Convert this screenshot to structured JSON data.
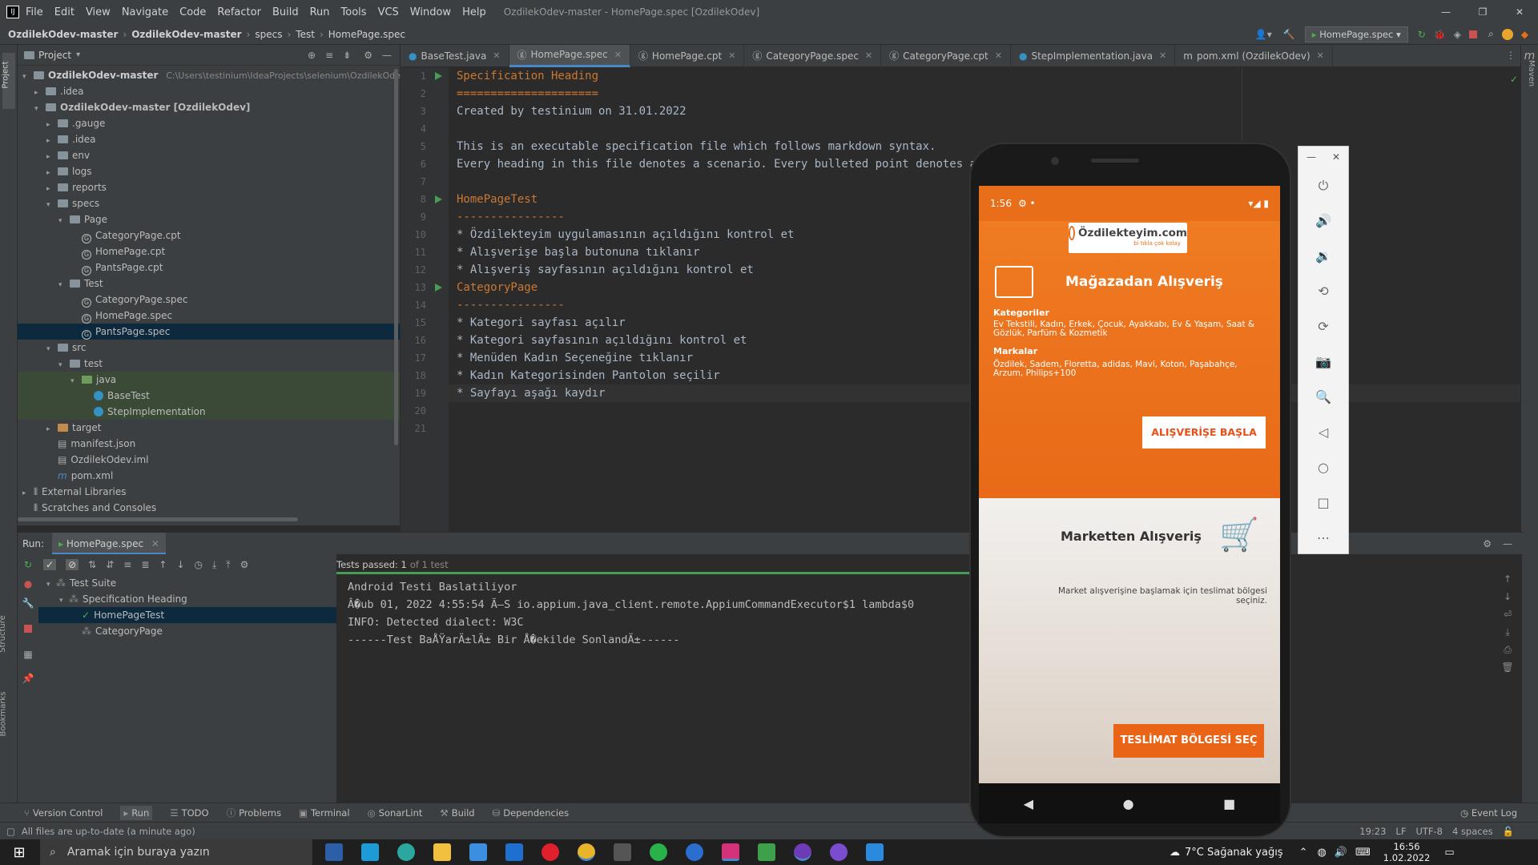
{
  "window": {
    "title": "OzdilekOdev-master - HomePage.spec [OzdilekOdev]"
  },
  "menu": [
    "File",
    "Edit",
    "View",
    "Navigate",
    "Code",
    "Refactor",
    "Build",
    "Run",
    "Tools",
    "VCS",
    "Window",
    "Help"
  ],
  "breadcrumb": [
    "OzdilekOdev-master",
    "OzdilekOdev-master",
    "specs",
    "Test",
    "HomePage.spec"
  ],
  "run_config": "HomePage.spec",
  "project": {
    "title": "Project",
    "root": "OzdilekOdev-master",
    "root_path": "C:\\Users\\testinium\\IdeaProjects\\selenium\\OzdilekOdev-m",
    "nodes": [
      {
        "label": ".idea",
        "depth": 1,
        "type": "folder",
        "arrow": "▸"
      },
      {
        "label": "OzdilekOdev-master [OzdilekOdev]",
        "depth": 1,
        "type": "folder",
        "arrow": "▾"
      },
      {
        "label": ".gauge",
        "depth": 2,
        "type": "folder",
        "arrow": "▸"
      },
      {
        "label": ".idea",
        "depth": 2,
        "type": "folder",
        "arrow": "▸"
      },
      {
        "label": "env",
        "depth": 2,
        "type": "folder",
        "arrow": "▸"
      },
      {
        "label": "logs",
        "depth": 2,
        "type": "folder",
        "arrow": "▸"
      },
      {
        "label": "reports",
        "depth": 2,
        "type": "folder",
        "arrow": "▸"
      },
      {
        "label": "specs",
        "depth": 2,
        "type": "folder",
        "arrow": "▾"
      },
      {
        "label": "Page",
        "depth": 3,
        "type": "folder",
        "arrow": "▾"
      },
      {
        "label": "CategoryPage.cpt",
        "depth": 4,
        "type": "spec",
        "arrow": ""
      },
      {
        "label": "HomePage.cpt",
        "depth": 4,
        "type": "spec",
        "arrow": ""
      },
      {
        "label": "PantsPage.cpt",
        "depth": 4,
        "type": "spec",
        "arrow": ""
      },
      {
        "label": "Test",
        "depth": 3,
        "type": "folder",
        "arrow": "▾"
      },
      {
        "label": "CategoryPage.spec",
        "depth": 4,
        "type": "spec",
        "arrow": ""
      },
      {
        "label": "HomePage.spec",
        "depth": 4,
        "type": "spec",
        "arrow": ""
      },
      {
        "label": "PantsPage.spec",
        "depth": 4,
        "type": "spec",
        "arrow": "",
        "selected": true
      },
      {
        "label": "src",
        "depth": 2,
        "type": "folder",
        "arrow": "▾"
      },
      {
        "label": "test",
        "depth": 3,
        "type": "folder",
        "arrow": "▾"
      },
      {
        "label": "java",
        "depth": 4,
        "type": "folder-green",
        "arrow": "▾",
        "hl": true
      },
      {
        "label": "BaseTest",
        "depth": 5,
        "type": "class",
        "arrow": "",
        "hl": true
      },
      {
        "label": "StepImplementation",
        "depth": 5,
        "type": "class",
        "arrow": "",
        "hl": true
      },
      {
        "label": "target",
        "depth": 2,
        "type": "folder-orange",
        "arrow": "▸"
      },
      {
        "label": "manifest.json",
        "depth": 2,
        "type": "file",
        "arrow": ""
      },
      {
        "label": "OzdilekOdev.iml",
        "depth": 2,
        "type": "file",
        "arrow": ""
      },
      {
        "label": "pom.xml",
        "depth": 2,
        "type": "maven",
        "arrow": ""
      },
      {
        "label": "External Libraries",
        "depth": 0,
        "type": "lib",
        "arrow": "▸"
      },
      {
        "label": "Scratches and Consoles",
        "depth": 0,
        "type": "lib",
        "arrow": ""
      }
    ]
  },
  "tabs": [
    {
      "label": "BaseTest.java",
      "active": false
    },
    {
      "label": "HomePage.spec",
      "active": true
    },
    {
      "label": "HomePage.cpt",
      "active": false
    },
    {
      "label": "CategoryPage.spec",
      "active": false
    },
    {
      "label": "CategoryPage.cpt",
      "active": false
    },
    {
      "label": "StepImplementation.java",
      "active": false
    },
    {
      "label": "pom.xml (OzdilekOdev)",
      "active": false
    }
  ],
  "code_lines": [
    "Specification Heading",
    "=====================",
    "Created by testinium on 31.01.2022",
    "",
    "This is an executable specification file which follows markdown syntax.",
    "Every heading in this file denotes a scenario. Every bulleted point denotes a step.",
    "",
    "HomePageTest",
    "----------------",
    "* Özdilekteyim uygulamasının açıldığını kontrol et",
    "* Alışverişe başla butonuna tıklanır",
    "* Alışveriş sayfasının açıldığını kontrol et",
    "CategoryPage",
    "----------------",
    "* Kategori sayfası açılır",
    "* Kategori sayfasının açıldığını kontrol et",
    "* Menüden Kadın Seçeneğine tıklanır",
    "* Kadın Kategorisinden Pantolon seçilir",
    "* Sayfayı aşağı kaydır",
    "",
    ""
  ],
  "run": {
    "label": "Run:",
    "config": "HomePage.spec",
    "tests_passed": "Tests passed: 1",
    "tests_total": "of 1 test",
    "tree": [
      {
        "label": "Test Suite",
        "depth": 0
      },
      {
        "label": "Specification Heading",
        "depth": 1
      },
      {
        "label": "HomePageTest",
        "depth": 2,
        "selected": true
      },
      {
        "label": "CategoryPage",
        "depth": 2
      }
    ],
    "console": [
      "Android Testi Baslatiliyor",
      "Â�ub 01, 2022 4:55:54 Ã–S io.appium.java_client.remote.AppiumCommandExecutor$1 lambda$0",
      "INFO: Detected dialect: W3C",
      "------Test BaÅŸarÄ±lÄ± Bir Å�ekilde SonlandÄ±------"
    ]
  },
  "bottom_tools": [
    "Version Control",
    "Run",
    "TODO",
    "Problems",
    "Terminal",
    "SonarLint",
    "Build",
    "Dependencies"
  ],
  "event_log": "Event Log",
  "status": {
    "message": "All files are up-to-date (a minute ago)",
    "position": "19:23",
    "line_sep": "LF",
    "encoding": "UTF-8",
    "indent": "4 spaces"
  },
  "side_labels": {
    "project": "Project",
    "structure": "Structure",
    "bookmarks": "Bookmarks",
    "maven": "Maven"
  },
  "phone": {
    "time": "1:56",
    "logo": "Özdilekteyim.com",
    "logo_sub": "bi tıkla çok kolay",
    "store_title": "Mağazadan Alışveriş",
    "categories_label": "Kategoriler",
    "categories_text": "Ev Tekstili, Kadın, Erkek, Çocuk, Ayakkabı, Ev & Yaşam, Saat & Gözlük, Parfüm & Kozmetik",
    "brands_label": "Markalar",
    "brands_text": "Özdilek, Sadem, Floretta, adidas, Mavi, Koton, Paşabahçe, Arzum, Philips+100",
    "start_button": "ALIŞVERİŞE BAŞLA",
    "market_title": "Marketten Alışveriş",
    "market_text": "Market alışverişine başlamak için teslimat bölgesi seçiniz.",
    "delivery_button": "TESLİMAT BÖLGESİ SEÇ"
  },
  "taskbar": {
    "search_placeholder": "Aramak için buraya yazın",
    "weather": "7°C Sağanak yağış",
    "clock_time": "16:56",
    "clock_date": "1.02.2022"
  },
  "colors": {
    "accent": "#e86e1a",
    "ide_bg": "#2b2b2b",
    "ide_panel": "#3c3f41",
    "keyword": "#cc7832",
    "run_green": "#499c54"
  }
}
